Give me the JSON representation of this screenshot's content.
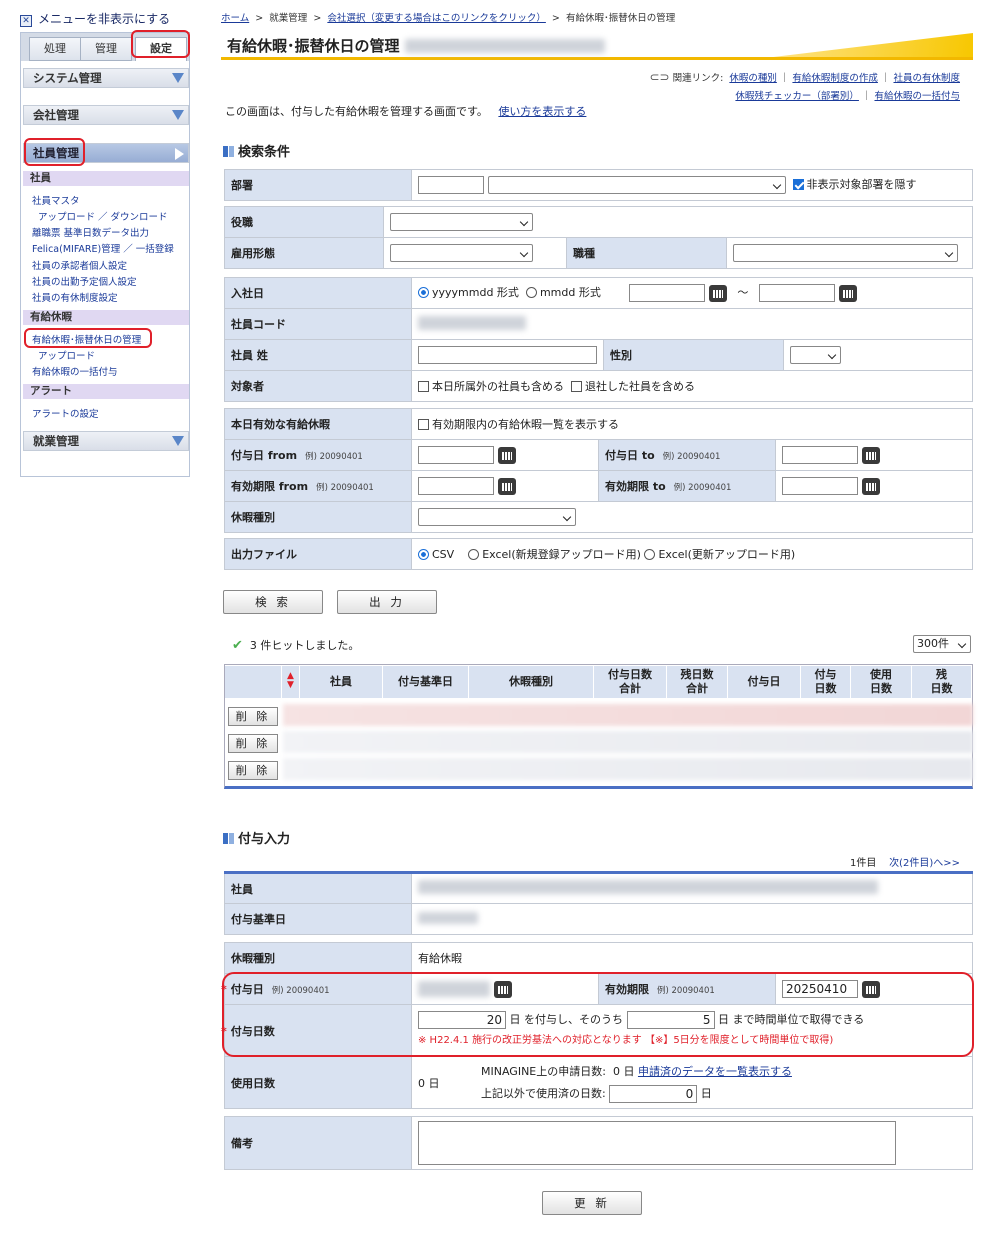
{
  "sidebar": {
    "toggle": "メニューを非表示にする",
    "tabs": [
      "処理",
      "管理",
      "設定"
    ],
    "sections": {
      "system": "システム管理",
      "company": "会社管理",
      "employee": "社員管理",
      "work": "就業管理"
    },
    "groups": {
      "employee": "社員",
      "leave": "有給休暇",
      "alert": "アラート"
    },
    "employee_items": [
      "社員マスタ",
      "アップロード ／ ダウンロード",
      "離職票 基準日数データ出力",
      "Felica(MIFARE)管理 ／ 一括登録",
      "社員の承認者個人設定",
      "社員の出勤予定個人設定",
      "社員の有休制度設定"
    ],
    "leave_items": [
      "有給休暇･振替休日の管理",
      "アップロード",
      "有給休暇の一括付与"
    ],
    "alert_items": [
      "アラートの設定"
    ]
  },
  "breadcrumb": {
    "home": "ホーム",
    "sep": ">",
    "work": "就業管理",
    "company": "会社選択（変更する場合はこのリンクをクリック）",
    "current": "有給休暇･振替休日の管理"
  },
  "page_title": "有給休暇･振替休日の管理",
  "related": {
    "label": "関連リンク:",
    "links": [
      "休暇の種別",
      "有給休暇制度の作成",
      "社員の有休制度",
      "休暇残チェッカー（部署別）",
      "有給休暇の一括付与"
    ]
  },
  "intro": {
    "text": "この画面は、付与した有給休暇を管理する画面です。",
    "link": "使い方を表示する"
  },
  "search": {
    "heading": "検索条件",
    "dept": "部署",
    "hide_dept": "非表示対象部署を隠す",
    "position": "役職",
    "employment": "雇用形態",
    "job": "職種",
    "joined": "入社日",
    "fmt1": "yyyymmdd 形式",
    "fmt2": "mmdd 形式",
    "tilde": "〜",
    "code": "社員コード",
    "surname": "社員 姓",
    "gender": "性別",
    "target": "対象者",
    "target_opt1": "本日所属外の社員も含める",
    "target_opt2": "退社した社員を含める",
    "valid_today": "本日有効な有給休暇",
    "valid_opt": "有効期限内の有給休暇一覧を表示する",
    "grant_from": "付与日 from",
    "grant_to": "付与日 to",
    "exp_from": "有効期限 from",
    "exp_to": "有効期限 to",
    "example": "例) 20090401",
    "leave_type": "休暇種別",
    "output": "出力ファイル",
    "out_csv": "CSV",
    "out_excel_new": "Excel(新規登録アップロード用)",
    "out_excel_upd": "Excel(更新アップロード用)"
  },
  "buttons": {
    "search": "検 索",
    "output": "出 力",
    "delete": "削 除",
    "update": "更 新"
  },
  "results": {
    "hits": "3 件ヒットしました。",
    "per_page": "300件"
  },
  "table": {
    "headers": [
      "社員",
      "付与基準日",
      "休暇種別",
      "付与日数\n合計",
      "残日数\n合計",
      "付与日",
      "付与\n日数",
      "使用\n日数",
      "残\n日数"
    ]
  },
  "grant": {
    "heading": "付与入力",
    "pager": "1件目",
    "next": "次(2件目)へ>>",
    "employee": "社員",
    "base_date": "付与基準日",
    "leave_type": "休暇種別",
    "leave_type_value": "有給休暇",
    "grant_date": "付与日",
    "example": "例) 20090401",
    "expiry": "有効期限",
    "expiry_value": "20250410",
    "days": "付与日数",
    "days_value": "20",
    "days_text1": "日 を付与し、そのうち",
    "hours_value": "5",
    "days_text2": "日 まで時間単位で取得できる",
    "notice": "※ H22.4.1 施行の改正労基法への対応となります 【※】5日分を限度として時間単位で取得)",
    "used": "使用日数",
    "used_value": "0 日",
    "app_days": "MINAGINE上の申請日数:",
    "app_days_value": "0 日",
    "app_link": "申請済のデータを一覧表示する",
    "other_used": "上記以外で使用済の日数:",
    "other_value": "0",
    "day_unit": "日",
    "memo": "備考"
  }
}
